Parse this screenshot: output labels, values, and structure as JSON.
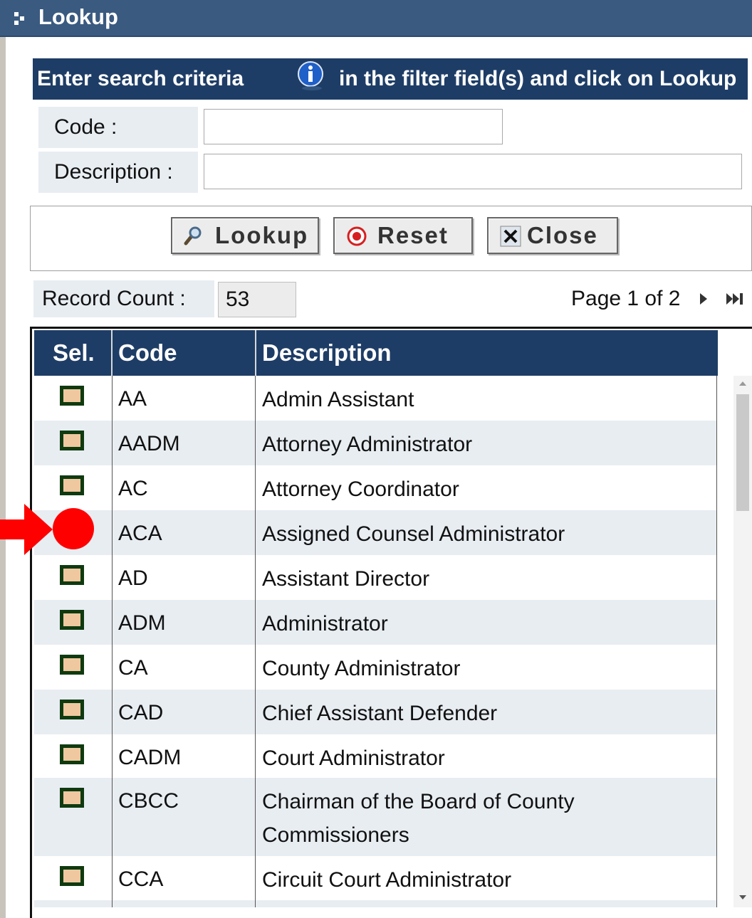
{
  "window": {
    "title": "Lookup"
  },
  "criteria": {
    "text_before": "Enter search criteria",
    "text_after": "in the filter field(s) and click on Lookup"
  },
  "filters": {
    "code_label": "Code :",
    "code_value": "",
    "description_label": "Description :",
    "description_value": ""
  },
  "buttons": {
    "lookup": "Lookup",
    "reset": "Reset",
    "close": "Close"
  },
  "records": {
    "count_label": "Record Count :",
    "count_value": "53",
    "page_text": "Page 1 of 2"
  },
  "grid": {
    "headers": {
      "sel": "Sel.",
      "code": "Code",
      "description": "Description"
    },
    "rows": [
      {
        "code": "AA",
        "description": "Admin Assistant"
      },
      {
        "code": "AADM",
        "description": "Attorney Administrator"
      },
      {
        "code": "AC",
        "description": "Attorney Coordinator"
      },
      {
        "code": "ACA",
        "description": "Assigned Counsel Administrator"
      },
      {
        "code": "AD",
        "description": "Assistant Director"
      },
      {
        "code": "ADM",
        "description": "Administrator"
      },
      {
        "code": "CA",
        "description": "County Administrator"
      },
      {
        "code": "CAD",
        "description": "Chief Assistant Defender"
      },
      {
        "code": "CADM",
        "description": "Court Administrator"
      },
      {
        "code": "CBCC",
        "description": "Chairman of the Board of County Commissioners"
      },
      {
        "code": "CCA",
        "description": "Circuit Court Administrator"
      }
    ]
  },
  "colors": {
    "header_bg": "#1e3d66",
    "title_bg": "#3a5a80",
    "alt_row_bg": "#e8edf2",
    "select_box_fill": "#f0c8a0",
    "select_box_border": "#0f3a10",
    "annotation_red": "#ff0000"
  },
  "icons": [
    "lookup-window-icon",
    "info-icon",
    "magnifier-icon",
    "reset-icon",
    "close-x-icon",
    "next-page-icon",
    "last-page-icon",
    "select-icon",
    "red-arrow-annotation",
    "red-dot-annotation"
  ]
}
